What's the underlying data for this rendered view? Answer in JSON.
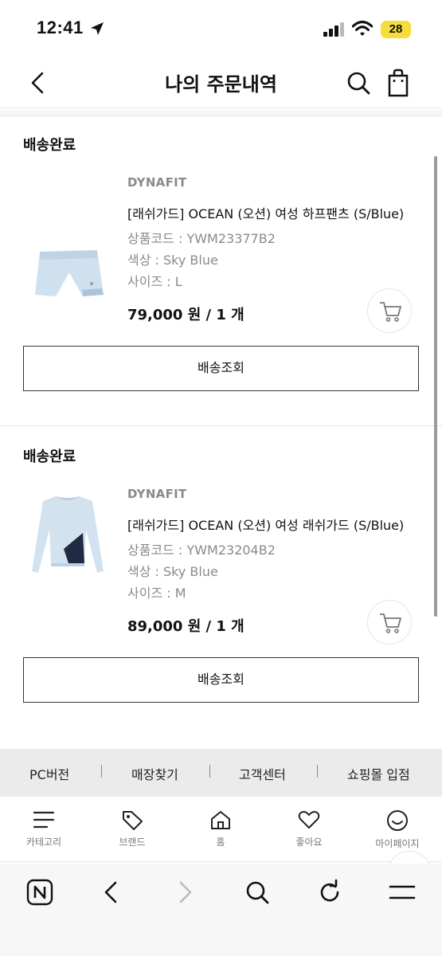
{
  "status_bar": {
    "time": "12:41",
    "battery": "28"
  },
  "header": {
    "title": "나의 주문내역"
  },
  "orders": [
    {
      "status": "배송완료",
      "brand": "DYNAFIT",
      "name": "[래쉬가드] OCEAN (오션) 여성 하프팬츠 (S/Blue)",
      "code": "상품코드 : YWM23377B2",
      "color": "색상 : Sky Blue",
      "size": "사이즈 : L",
      "price": "79,000 원 / 1 개",
      "track_label": "배송조회"
    },
    {
      "status": "배송완료",
      "brand": "DYNAFIT",
      "name": "[래쉬가드] OCEAN (오션) 여성 래쉬가드 (S/Blue)",
      "code": "상품코드 : YWM23204B2",
      "color": "색상 : Sky Blue",
      "size": "사이즈 : M",
      "price": "89,000 원 / 1 개",
      "track_label": "배송조회"
    }
  ],
  "footer_links": [
    "PC버전",
    "매장찾기",
    "고객센터",
    "쇼핑몰 입점"
  ],
  "tab_bar": {
    "items": [
      {
        "label": "카테고리",
        "icon": "menu-icon"
      },
      {
        "label": "브랜드",
        "icon": "tag-icon"
      },
      {
        "label": "홈",
        "icon": "home-icon"
      },
      {
        "label": "좋아요",
        "icon": "heart-icon"
      },
      {
        "label": "마이페이지",
        "icon": "smile-icon"
      }
    ]
  },
  "browser_toolbar": {
    "icons": [
      "naver-icon",
      "back-arrow-icon",
      "forward-arrow-icon",
      "search-icon",
      "refresh-icon",
      "menu-icon"
    ]
  },
  "colors": {
    "accent": "#f5de3b",
    "muted_text": "#8a8a8a",
    "product_blue": "#c9dced"
  }
}
